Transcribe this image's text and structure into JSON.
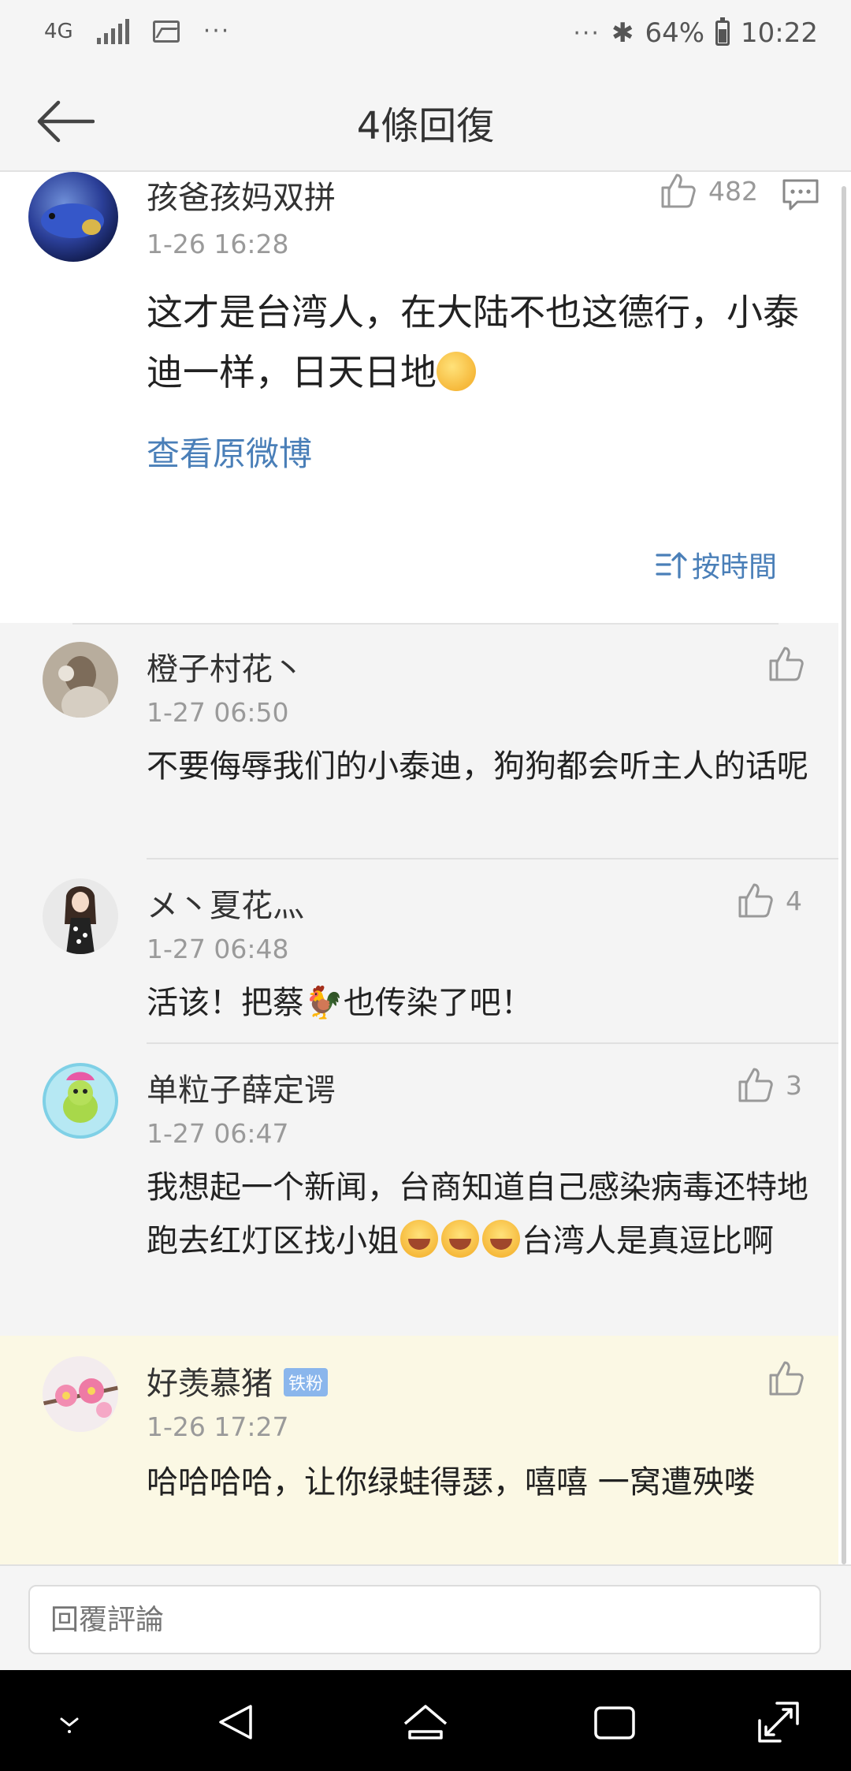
{
  "status_bar": {
    "network": "4G",
    "more": "···",
    "more_right": "···",
    "battery": "64%",
    "time": "10:22"
  },
  "header": {
    "title": "4條回復"
  },
  "main_comment": {
    "username": "孩爸孩妈双拼",
    "time": "1-26 16:28",
    "likes": "482",
    "text": "这才是台湾人，在大陆不也这德行，小泰迪一样，日天日地",
    "view_original": "查看原微博",
    "sort_label": "按時間"
  },
  "replies": [
    {
      "username": "橙子村花丶",
      "time": "1-27 06:50",
      "likes": "",
      "text": "不要侮辱我们的小泰迪，狗狗都会听主人的话呢"
    },
    {
      "username": "メ丶夏花灬",
      "time": "1-27 06:48",
      "likes": "4",
      "text_before": "活该！把蔡",
      "text_after": "也传染了吧！"
    },
    {
      "username": "单粒子薛定谔",
      "time": "1-27 06:47",
      "likes": "3",
      "text_before": "我想起一个新闻，台商知道自己感染病毒还特地跑去红灯区找小姐",
      "text_after": "台湾人是真逗比啊"
    },
    {
      "username": "好羡慕猪",
      "badge": "铁粉",
      "time": "1-26 17:27",
      "likes": "",
      "text": "哈哈哈哈，让你绿蛙得瑟，嘻嘻 一窝遭殃喽"
    }
  ],
  "input": {
    "placeholder": "回覆評論"
  },
  "colors": {
    "link": "#4a7fb8",
    "highlight_bg": "#fbf8e4",
    "badge": "#8ab6ec"
  }
}
